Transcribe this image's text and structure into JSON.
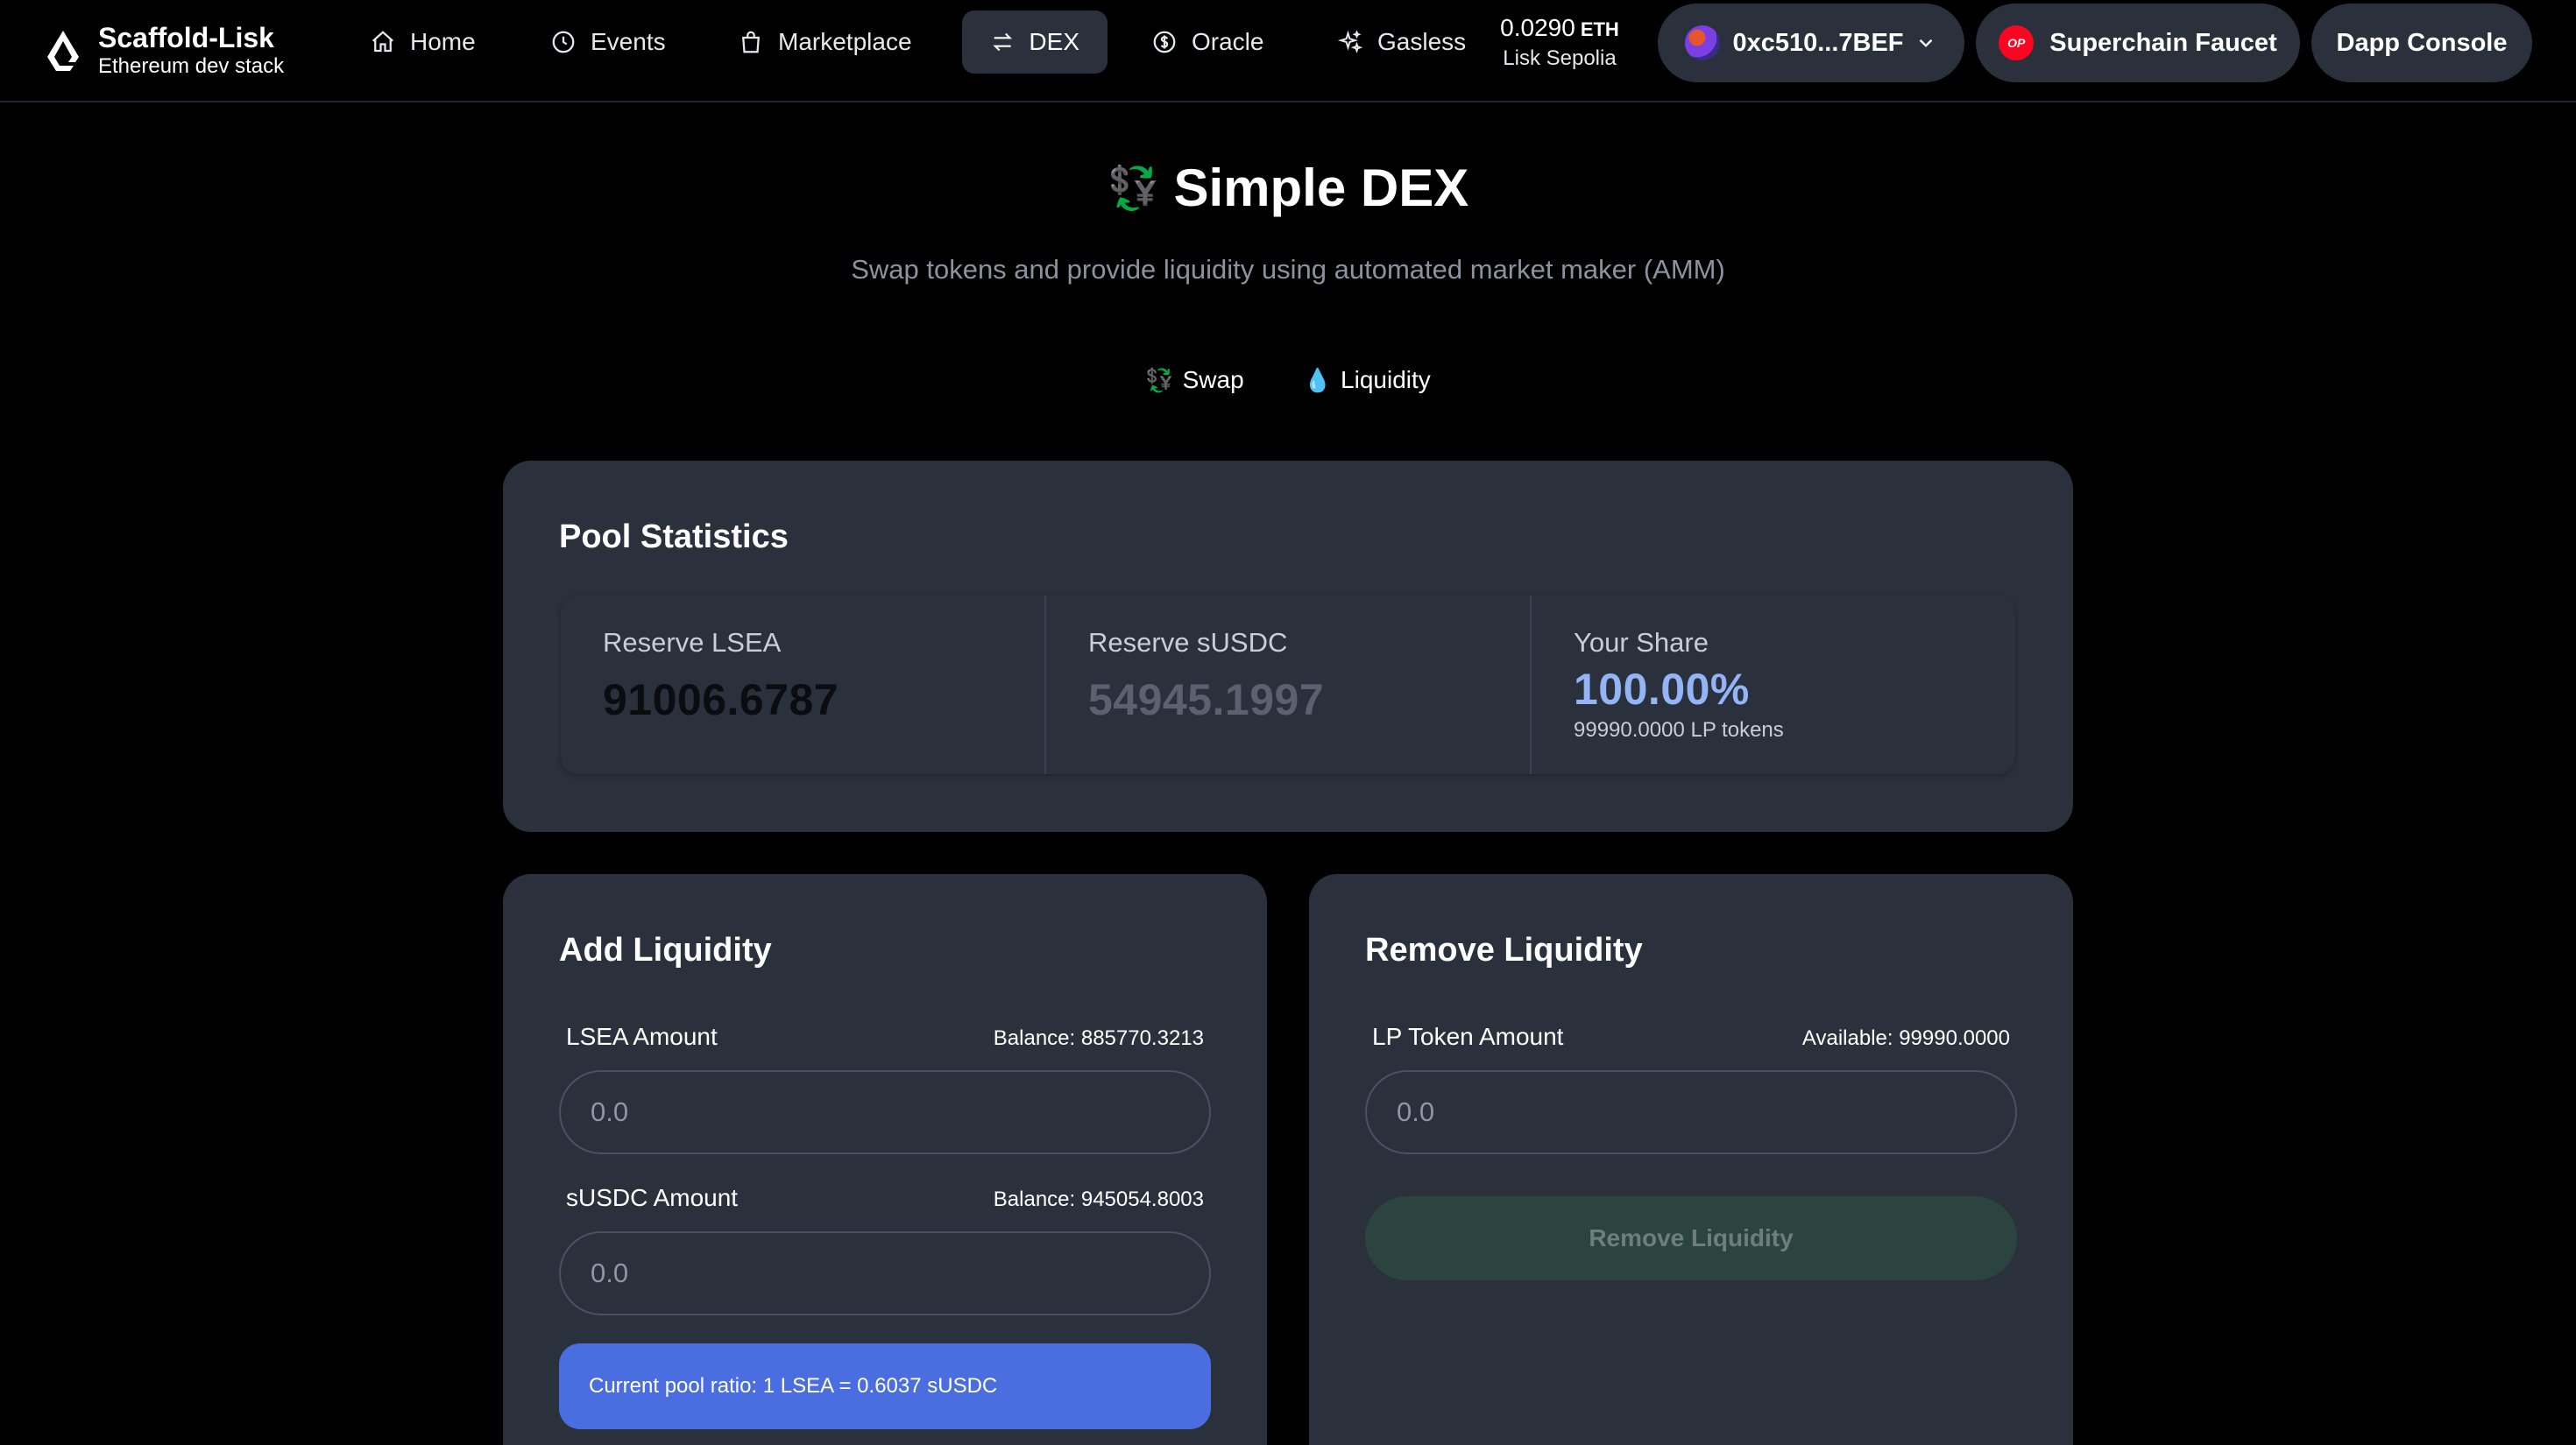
{
  "brand": {
    "title": "Scaffold-Lisk",
    "subtitle": "Ethereum dev stack"
  },
  "nav": {
    "home": "Home",
    "events": "Events",
    "marketplace": "Marketplace",
    "dex": "DEX",
    "oracle": "Oracle",
    "gasless": "Gasless"
  },
  "wallet": {
    "balance": "0.0290",
    "balance_unit": "ETH",
    "network": "Lisk Sepolia",
    "address": "0xc510...7BEF",
    "faucet_label": "Superchain Faucet",
    "faucet_badge": "OP",
    "console_label": "Dapp Console"
  },
  "page": {
    "title": "Simple DEX",
    "title_icon": "💱",
    "subtitle": "Swap tokens and provide liquidity using automated market maker (AMM)",
    "tabs": {
      "swap": "Swap",
      "liquidity": "Liquidity"
    }
  },
  "pool": {
    "title": "Pool Statistics",
    "reserve_a_label": "Reserve LSEA",
    "reserve_a_value": "91006.6787",
    "reserve_b_label": "Reserve sUSDC",
    "reserve_b_value": "54945.1997",
    "share_label": "Your Share",
    "share_value": "100.00%",
    "share_desc": "99990.0000 LP tokens"
  },
  "add": {
    "title": "Add Liquidity",
    "lsea_label": "LSEA Amount",
    "lsea_balance": "Balance: 885770.3213",
    "lsea_placeholder": "0.0",
    "susdc_label": "sUSDC Amount",
    "susdc_balance": "Balance: 945054.8003",
    "susdc_placeholder": "0.0",
    "ratio": "Current pool ratio: 1 LSEA = 0.6037 sUSDC"
  },
  "remove": {
    "title": "Remove Liquidity",
    "lp_label": "LP Token Amount",
    "lp_available": "Available: 99990.0000",
    "lp_placeholder": "0.0",
    "button": "Remove Liquidity"
  },
  "colors": {
    "background": "#000000",
    "card": "#2a303c",
    "accent_blue": "#4a6ee0",
    "share_blue": "#93b4f5",
    "remove_button": "#2c4440"
  }
}
